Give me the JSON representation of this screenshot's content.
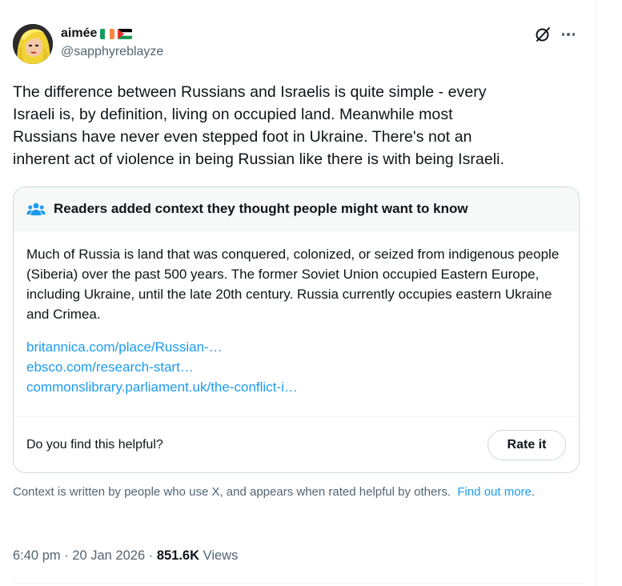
{
  "author": {
    "display_name": "aimée",
    "handle": "@sapphyreblayze",
    "flags": [
      "ireland-flag",
      "palestine-flag"
    ]
  },
  "header_icons": [
    "grok-icon",
    "more-icon"
  ],
  "tweet": {
    "text": "The difference between Russians and Israelis is quite simple - every\nIsraeli is, by definition, living on occupied land. Meanwhile most\nRussians have never even stepped foot in Ukraine. There's not an\ninherent act of violence in being Russian like there is with being Israeli."
  },
  "community_note": {
    "title": "Readers added context they thought people might want to know",
    "body": "Much of Russia is land that was conquered, colonized, or seized from indigenous people (Siberia) over the past 500 years. The former Soviet Union occupied Eastern Europe, including Ukraine, until the late 20th century. Russia currently occupies eastern Ukraine and Crimea.",
    "links": [
      "britannica.com/place/Russian-…",
      "ebsco.com/research-start…",
      "commonslibrary.parliament.uk/the-conflict-i…"
    ],
    "helpful_question": "Do you find this helpful?",
    "rate_label": "Rate it"
  },
  "context_info": {
    "text": "Context is written by people who use X, and appears when rated helpful by others.",
    "link_label": "Find out more",
    "end": "."
  },
  "meta": {
    "time": "6:40 pm",
    "sep1": " · ",
    "date": "20 Jan 2026",
    "sep2": " · ",
    "views_count": "851.6K",
    "views_label": " Views"
  },
  "colors": {
    "link": "#1d9bf0",
    "secondary_text": "#536471",
    "primary_text": "#0f1419",
    "border": "#cfd9de"
  }
}
